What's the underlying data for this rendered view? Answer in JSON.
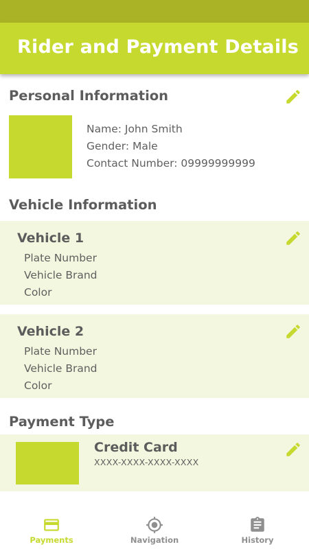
{
  "colors": {
    "accent": "#c6d92e",
    "status_bar": "#aab326",
    "card_background": "#f4f7df",
    "text": "#5f5f5f",
    "nav_inactive": "#8f8f8f"
  },
  "header": {
    "title": "Rider and Payment Details"
  },
  "personal": {
    "title": "Personal Information",
    "edit_icon": "pencil-icon",
    "name": "Name: John Smith",
    "gender": "Gender: Male",
    "contact": "Contact Number: 09999999999"
  },
  "vehicles": {
    "title": "Vehicle Information",
    "items": [
      {
        "name": "Vehicle 1",
        "plate": "Plate Number",
        "brand": "Vehicle Brand",
        "color": "Color"
      },
      {
        "name": "Vehicle 2",
        "plate": "Plate Number",
        "brand": "Vehicle Brand",
        "color": "Color"
      }
    ]
  },
  "payment": {
    "title": "Payment Type",
    "card_type": "Credit Card",
    "card_number": "XXXX-XXXX-XXXX-XXXX"
  },
  "nav": {
    "items": [
      {
        "label": "Payments",
        "icon": "credit-card-icon",
        "active": true
      },
      {
        "label": "Navigation",
        "icon": "crosshair-icon",
        "active": false
      },
      {
        "label": "History",
        "icon": "clipboard-icon",
        "active": false
      }
    ]
  }
}
